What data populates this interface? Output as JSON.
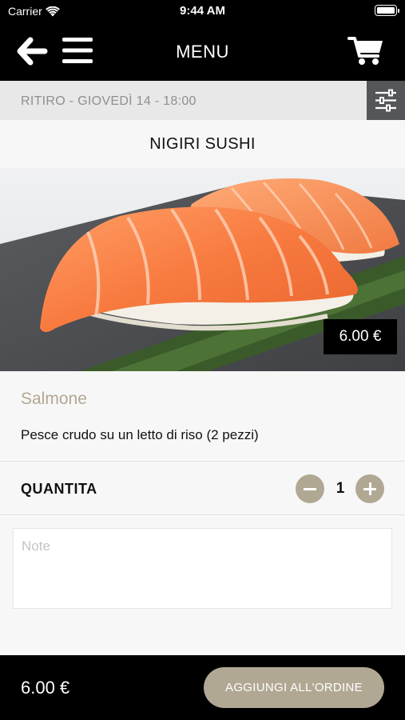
{
  "status_bar": {
    "carrier": "Carrier",
    "time": "9:44 AM"
  },
  "nav": {
    "title": "MENU"
  },
  "pickup": {
    "label": "RITIRO - GIOVEDÌ 14 - 18:00"
  },
  "category": {
    "title": "NIGIRI SUSHI"
  },
  "product": {
    "price": "6.00 €",
    "name": "Salmone",
    "description": "Pesce crudo su un letto di riso (2 pezzi)"
  },
  "quantity": {
    "label": "QUANTITA",
    "value": "1"
  },
  "notes": {
    "placeholder": "Note"
  },
  "footer": {
    "total": "6.00 €",
    "add_label": "AGGIUNGI ALL'ORDINE"
  },
  "colors": {
    "accent": "#b1a894",
    "header_bg": "#000000",
    "filter_bg": "#555659",
    "product_name": "#b3a792"
  }
}
